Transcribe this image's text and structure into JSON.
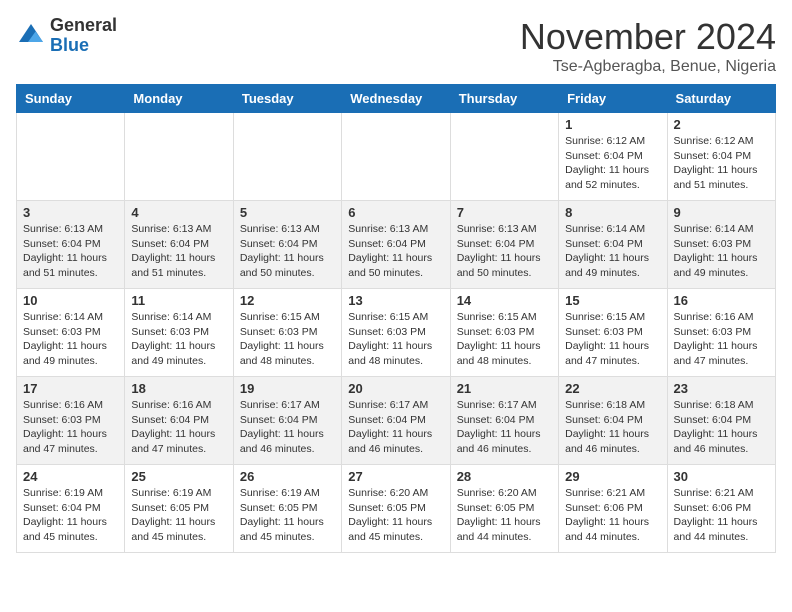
{
  "logo": {
    "general": "General",
    "blue": "Blue"
  },
  "title": "November 2024",
  "subtitle": "Tse-Agberagba, Benue, Nigeria",
  "weekdays": [
    "Sunday",
    "Monday",
    "Tuesday",
    "Wednesday",
    "Thursday",
    "Friday",
    "Saturday"
  ],
  "weeks": [
    [
      {
        "day": "",
        "info": ""
      },
      {
        "day": "",
        "info": ""
      },
      {
        "day": "",
        "info": ""
      },
      {
        "day": "",
        "info": ""
      },
      {
        "day": "",
        "info": ""
      },
      {
        "day": "1",
        "info": "Sunrise: 6:12 AM\nSunset: 6:04 PM\nDaylight: 11 hours\nand 52 minutes."
      },
      {
        "day": "2",
        "info": "Sunrise: 6:12 AM\nSunset: 6:04 PM\nDaylight: 11 hours\nand 51 minutes."
      }
    ],
    [
      {
        "day": "3",
        "info": "Sunrise: 6:13 AM\nSunset: 6:04 PM\nDaylight: 11 hours\nand 51 minutes."
      },
      {
        "day": "4",
        "info": "Sunrise: 6:13 AM\nSunset: 6:04 PM\nDaylight: 11 hours\nand 51 minutes."
      },
      {
        "day": "5",
        "info": "Sunrise: 6:13 AM\nSunset: 6:04 PM\nDaylight: 11 hours\nand 50 minutes."
      },
      {
        "day": "6",
        "info": "Sunrise: 6:13 AM\nSunset: 6:04 PM\nDaylight: 11 hours\nand 50 minutes."
      },
      {
        "day": "7",
        "info": "Sunrise: 6:13 AM\nSunset: 6:04 PM\nDaylight: 11 hours\nand 50 minutes."
      },
      {
        "day": "8",
        "info": "Sunrise: 6:14 AM\nSunset: 6:04 PM\nDaylight: 11 hours\nand 49 minutes."
      },
      {
        "day": "9",
        "info": "Sunrise: 6:14 AM\nSunset: 6:03 PM\nDaylight: 11 hours\nand 49 minutes."
      }
    ],
    [
      {
        "day": "10",
        "info": "Sunrise: 6:14 AM\nSunset: 6:03 PM\nDaylight: 11 hours\nand 49 minutes."
      },
      {
        "day": "11",
        "info": "Sunrise: 6:14 AM\nSunset: 6:03 PM\nDaylight: 11 hours\nand 49 minutes."
      },
      {
        "day": "12",
        "info": "Sunrise: 6:15 AM\nSunset: 6:03 PM\nDaylight: 11 hours\nand 48 minutes."
      },
      {
        "day": "13",
        "info": "Sunrise: 6:15 AM\nSunset: 6:03 PM\nDaylight: 11 hours\nand 48 minutes."
      },
      {
        "day": "14",
        "info": "Sunrise: 6:15 AM\nSunset: 6:03 PM\nDaylight: 11 hours\nand 48 minutes."
      },
      {
        "day": "15",
        "info": "Sunrise: 6:15 AM\nSunset: 6:03 PM\nDaylight: 11 hours\nand 47 minutes."
      },
      {
        "day": "16",
        "info": "Sunrise: 6:16 AM\nSunset: 6:03 PM\nDaylight: 11 hours\nand 47 minutes."
      }
    ],
    [
      {
        "day": "17",
        "info": "Sunrise: 6:16 AM\nSunset: 6:03 PM\nDaylight: 11 hours\nand 47 minutes."
      },
      {
        "day": "18",
        "info": "Sunrise: 6:16 AM\nSunset: 6:04 PM\nDaylight: 11 hours\nand 47 minutes."
      },
      {
        "day": "19",
        "info": "Sunrise: 6:17 AM\nSunset: 6:04 PM\nDaylight: 11 hours\nand 46 minutes."
      },
      {
        "day": "20",
        "info": "Sunrise: 6:17 AM\nSunset: 6:04 PM\nDaylight: 11 hours\nand 46 minutes."
      },
      {
        "day": "21",
        "info": "Sunrise: 6:17 AM\nSunset: 6:04 PM\nDaylight: 11 hours\nand 46 minutes."
      },
      {
        "day": "22",
        "info": "Sunrise: 6:18 AM\nSunset: 6:04 PM\nDaylight: 11 hours\nand 46 minutes."
      },
      {
        "day": "23",
        "info": "Sunrise: 6:18 AM\nSunset: 6:04 PM\nDaylight: 11 hours\nand 46 minutes."
      }
    ],
    [
      {
        "day": "24",
        "info": "Sunrise: 6:19 AM\nSunset: 6:04 PM\nDaylight: 11 hours\nand 45 minutes."
      },
      {
        "day": "25",
        "info": "Sunrise: 6:19 AM\nSunset: 6:05 PM\nDaylight: 11 hours\nand 45 minutes."
      },
      {
        "day": "26",
        "info": "Sunrise: 6:19 AM\nSunset: 6:05 PM\nDaylight: 11 hours\nand 45 minutes."
      },
      {
        "day": "27",
        "info": "Sunrise: 6:20 AM\nSunset: 6:05 PM\nDaylight: 11 hours\nand 45 minutes."
      },
      {
        "day": "28",
        "info": "Sunrise: 6:20 AM\nSunset: 6:05 PM\nDaylight: 11 hours\nand 44 minutes."
      },
      {
        "day": "29",
        "info": "Sunrise: 6:21 AM\nSunset: 6:06 PM\nDaylight: 11 hours\nand 44 minutes."
      },
      {
        "day": "30",
        "info": "Sunrise: 6:21 AM\nSunset: 6:06 PM\nDaylight: 11 hours\nand 44 minutes."
      }
    ]
  ]
}
